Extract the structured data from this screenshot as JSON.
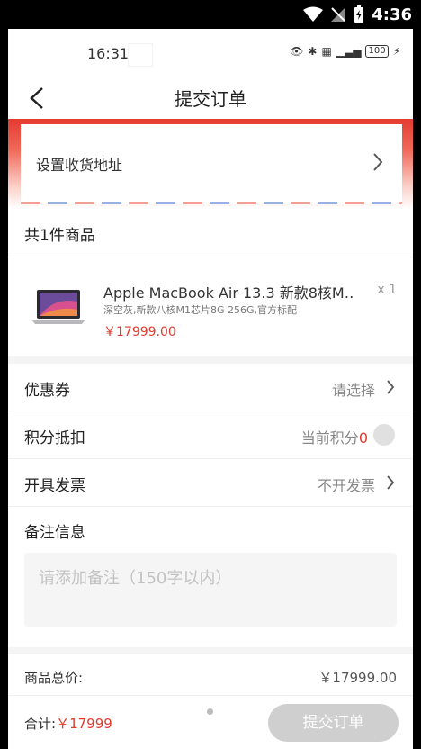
{
  "device_status": {
    "time": "4:36"
  },
  "inner_status": {
    "time": "16:31",
    "battery": "100"
  },
  "nav": {
    "title": "提交订单"
  },
  "address": {
    "label": "设置收货地址"
  },
  "goods_header": "共1件商品",
  "product": {
    "name": "Apple MacBook Air 13.3 新款8核M…",
    "spec": "深空灰,新款八核M1芯片8G 256G,官方标配",
    "price": "￥17999.00",
    "qty": "x 1"
  },
  "coupon": {
    "label": "优惠券",
    "value": "请选择"
  },
  "points": {
    "label": "积分抵扣",
    "text": "当前积分",
    "value": "0"
  },
  "invoice": {
    "label": "开具发票",
    "value": "不开发票"
  },
  "remark": {
    "label": "备注信息",
    "placeholder": "请添加备注（150字以内）"
  },
  "summary": {
    "label": "商品总价:",
    "value": "￥17999.00"
  },
  "bottom": {
    "total_label": "合计:",
    "total_value": "￥17999",
    "submit_label": "提交订单"
  },
  "colors": {
    "accent": "#e23b2e",
    "disabled_button": "#cfcfcf"
  }
}
